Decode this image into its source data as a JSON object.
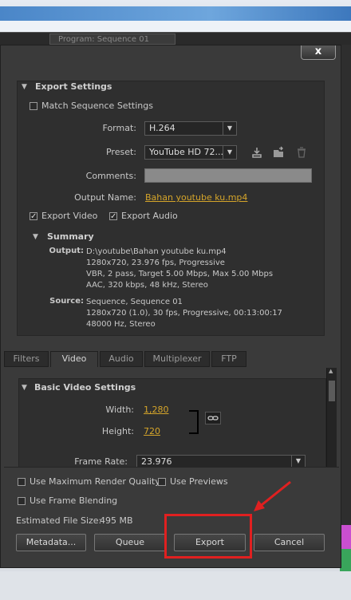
{
  "background": {
    "sequence_tab_label": "Program: Sequence 01",
    "accent_colors": [
      "#c94fd0",
      "#39a55b"
    ]
  },
  "dialog": {
    "close_label": "x",
    "export_settings": {
      "title": "Export Settings",
      "match_sequence_label": "Match Sequence Settings",
      "match_sequence_checked": false,
      "format_label": "Format:",
      "format_value": "H.264",
      "preset_label": "Preset:",
      "preset_value": "YouTube HD 72...",
      "comments_label": "Comments:",
      "comments_value": "",
      "output_name_label": "Output Name:",
      "output_name_value": "Bahan youtube ku.mp4",
      "export_video_label": "Export Video",
      "export_video_checked": true,
      "export_audio_label": "Export Audio",
      "export_audio_checked": true
    },
    "summary": {
      "title": "Summary",
      "output_label": "Output:",
      "output_text": "D:\\youtube\\Bahan youtube ku.mp4\n1280x720, 23.976 fps, Progressive\nVBR, 2 pass, Target 5.00 Mbps, Max 5.00 Mbps\nAAC, 320 kbps, 48 kHz, Stereo",
      "source_label": "Source:",
      "source_text": "Sequence, Sequence 01\n1280x720 (1.0), 30 fps, Progressive, 00:13:00:17\n48000 Hz, Stereo"
    },
    "tabs": [
      "Filters",
      "Video",
      "Audio",
      "Multiplexer",
      "FTP"
    ],
    "active_tab": "Video",
    "video": {
      "section_title": "Basic Video Settings",
      "width_label": "Width:",
      "width_value": "1,280",
      "height_label": "Height:",
      "height_value": "720",
      "frame_rate_label": "Frame Rate:",
      "frame_rate_value": "23.976"
    },
    "options": {
      "max_render_label": "Use Maximum Render Quality",
      "previews_label": "Use Previews",
      "frame_blending_label": "Use Frame Blending",
      "file_size_label": "Estimated File Size:",
      "file_size_value": "495 MB"
    },
    "buttons": {
      "metadata": "Metadata...",
      "queue": "Queue",
      "export": "Export",
      "cancel": "Cancel"
    },
    "annotation_color": "#e02020"
  }
}
